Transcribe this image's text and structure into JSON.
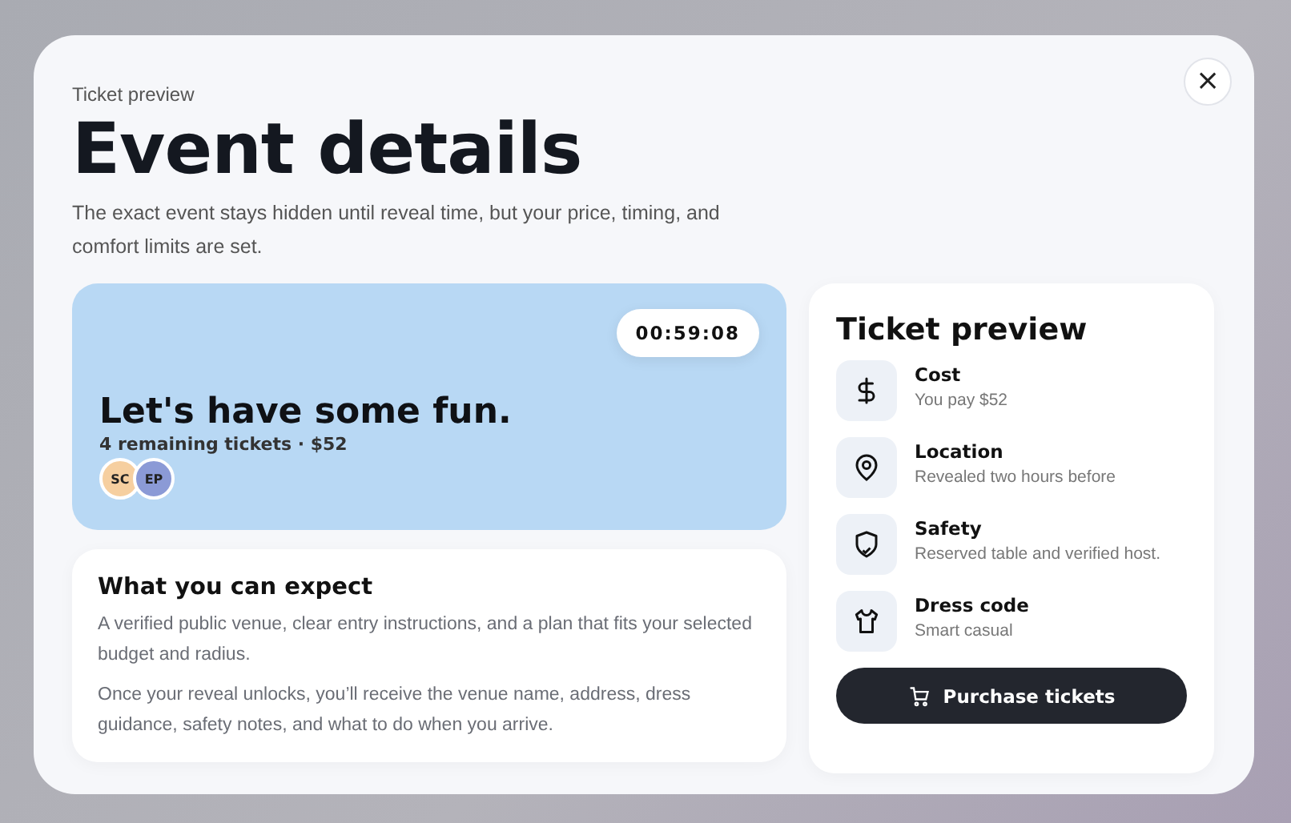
{
  "eyebrow": "Ticket preview",
  "title": "Event details",
  "intro": "The exact event stays hidden until reveal time, but your price, timing, and comfort limits are set.",
  "close": {
    "label": "×"
  },
  "hero": {
    "countdown": "00:59:08",
    "headline": "Let's have some fun.",
    "subline": "4 remaining tickets · $52",
    "avatars": [
      {
        "initials": "SC",
        "color": "#f6cfa0"
      },
      {
        "initials": "EP",
        "color": "#8b9ad6"
      }
    ]
  },
  "expect": {
    "title": "What you can expect",
    "paragraphs": [
      "A verified public venue, clear entry instructions, and a plan that fits your selected budget and radius.",
      "Once your reveal unlocks, you’ll receive the venue name, address, dress guidance, safety notes, and what to do when you arrive."
    ]
  },
  "preview": {
    "title": "Ticket preview",
    "items": [
      {
        "kind": "cost",
        "label": "Cost",
        "detail": "You pay $52"
      },
      {
        "kind": "location",
        "label": "Location",
        "detail": "Revealed two hours before"
      },
      {
        "kind": "safety",
        "label": "Safety",
        "detail": "Reserved table and verified host."
      },
      {
        "kind": "dress",
        "label": "Dress code",
        "detail": "Smart casual"
      }
    ],
    "button": "Purchase tickets"
  }
}
